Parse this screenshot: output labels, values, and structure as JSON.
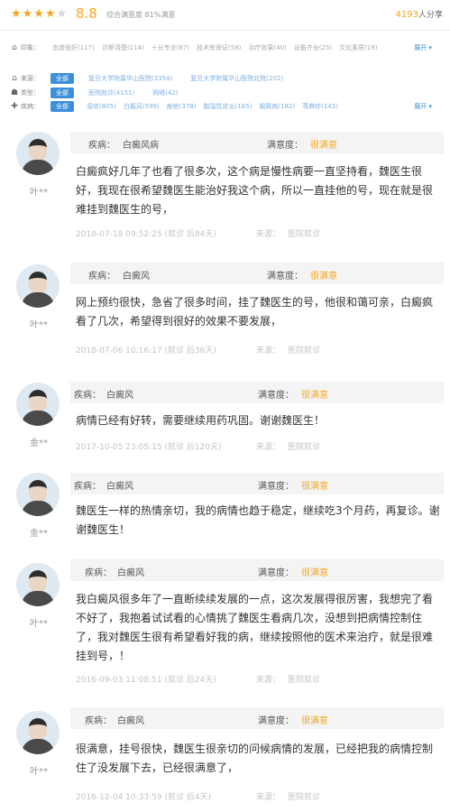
{
  "header": {
    "stars": "★★★★",
    "half_star": "★",
    "score": "8.8",
    "info": "综合满意度 81%满意",
    "count_number": "4193",
    "count_suffix": "人分享"
  },
  "filters": {
    "tags_row": {
      "icon": "tag-icon",
      "label": "印象：",
      "items": [
        "态度很好(117)",
        "诊断清楚(114)",
        "十分专业(87)",
        "技术有保证(58)",
        "治疗效果(40)",
        "设备齐全(25)",
        "文化素质(19)"
      ],
      "more": "展开 ▾"
    },
    "source_row": {
      "icon": "home-icon",
      "label": "来源：",
      "items": [
        "全部",
        "复旦大学附属华山医院(3354)",
        "复旦大学附属华山医院北院(202)"
      ]
    },
    "type_row": {
      "icon": "person-icon",
      "label": "类型：",
      "items": [
        "全部",
        "医院就诊(4151)",
        "网络(42)"
      ]
    },
    "disease_row": {
      "icon": "pill-icon",
      "label": "疾病：",
      "items": [
        "全部",
        "湿疹(805)",
        "白癜风(599)",
        "痤疮(378)",
        "脂溢性皮炎(185)",
        "银屑病(182)",
        "荨麻疹(143)"
      ],
      "more": "展开 ▾"
    }
  },
  "reviews": [
    {
      "user": "叶**",
      "disease_label": "疾病：",
      "disease": "白癜风病",
      "satisfaction_label": "满意度：",
      "satisfaction": "很满意",
      "text": "白癜疯好几年了也看了很多次，这个病是慢性病要一直坚持看，魏医生很好，我现在很希望魏医生能治好我这个病，所以一直挂他的号，现在就是很难挂到魏医生的号，",
      "date": "2018-07-18 09:52:25 (就诊 后84天)",
      "source_label": "来源：",
      "source": "医院就诊"
    },
    {
      "user": "叶**",
      "disease_label": "疾病：",
      "disease": "白癜风",
      "satisfaction_label": "满意度：",
      "satisfaction": "很满意",
      "text": "网上预约很快，急省了很多时间，挂了魏医生的号，他很和蔼可亲，白癜疯看了几次，希望得到很好的效果不要发展，",
      "date": "2018-07-06 10:16:17 (就诊 后36天)",
      "source_label": "来源：",
      "source": "医院就诊"
    },
    {
      "user": "金**",
      "disease_label": "疾病：",
      "disease": "白癜风",
      "satisfaction_label": "满意度：",
      "satisfaction": "很满意",
      "text": "病情已经有好转，需要继续用药巩固。谢谢魏医生！",
      "date": "2017-10-05 23:05:15 (就诊 后120天)",
      "source_label": "来源：",
      "source": "医院就诊"
    },
    {
      "user": "金**",
      "disease_label": "疾病：",
      "disease": "白癜风",
      "satisfaction_label": "满意度：",
      "satisfaction": "很满意",
      "text": "魏医生一样的热情亲切，我的病情也趋于稳定，继续吃3个月药，再复诊。谢谢魏医生！",
      "date": "",
      "source_label": "",
      "source": ""
    },
    {
      "user": "叶**",
      "disease_label": "疾病：",
      "disease": "白癜风",
      "satisfaction_label": "满意度：",
      "satisfaction": "很满意",
      "text": "我白癜风很多年了一直断续续发展的一点，这次发展得很厉害，我想完了看不好了，我抱着试试看的心情挑了魏医生看病几次，没想到把病情控制住了，我对魏医生很有希望看好我的病，继续按照他的医术来治疗，就是很难挂到号，！",
      "date": "2016-09-03 11:08:51 (就诊 后24天)",
      "source_label": "来源：",
      "source": "医院就诊"
    },
    {
      "user": "叶**",
      "disease_label": "疾病：",
      "disease": "白癜风",
      "satisfaction_label": "满意度：",
      "satisfaction": "很满意",
      "text": "很满意，挂号很快，魏医生很亲切的问候病情的发展，已经把我的病情控制住了没发展下去，已经很满意了，",
      "date": "2016-12-04 10:33:59 (就诊 后4天)",
      "source_label": "来源：",
      "source": "医院就诊"
    }
  ],
  "colors": {
    "accent": "#f5a623",
    "tag_active": "#3d8fd9",
    "meta_bg": "#f4f4f4"
  }
}
